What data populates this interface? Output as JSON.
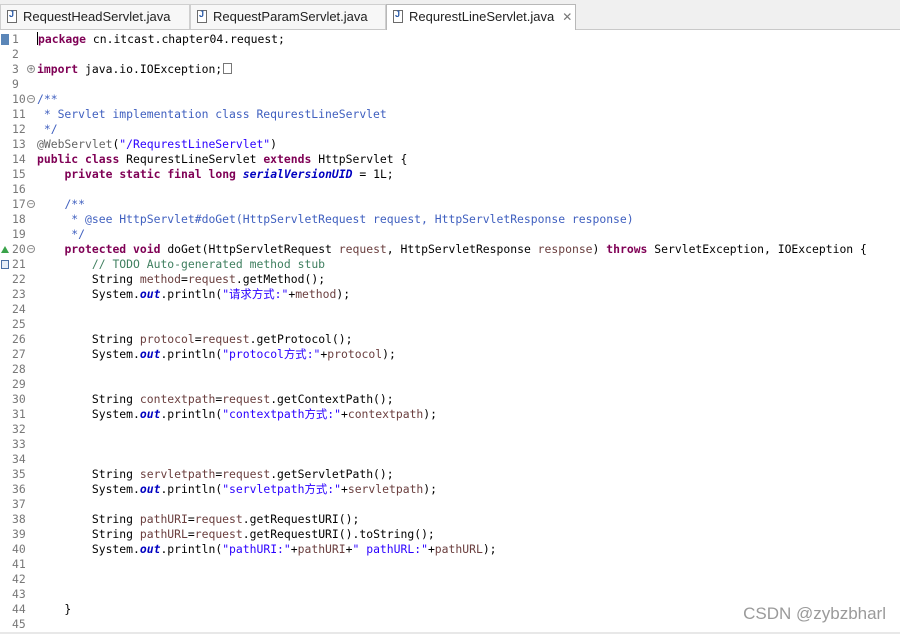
{
  "tabs": [
    {
      "label": "RequestHeadServlet.java",
      "active": false,
      "icon": "java-file-icon"
    },
    {
      "label": "RequestParamServlet.java",
      "active": false,
      "icon": "java-file-icon"
    },
    {
      "label": "RequrestLineServlet.java",
      "active": true,
      "icon": "java-file-icon",
      "close": "✕"
    }
  ],
  "colors": {
    "keyword": "#7f0055",
    "javadoc": "#3f5fbf",
    "line_comment": "#3f7f5f",
    "string": "#2a00ff",
    "annotation": "#646464",
    "field": "#0000c0",
    "variable": "#6a3e3e"
  },
  "fold_glyphs": {
    "expanded": "−",
    "collapsed": "+"
  },
  "code": [
    {
      "n": "1",
      "tokens": [
        [
          "kw",
          "package"
        ],
        [
          "pl",
          " cn.itcast.chapter04.request;"
        ]
      ]
    },
    {
      "n": "2",
      "tokens": []
    },
    {
      "n": "3",
      "fold": "collapsed",
      "tokens": [
        [
          "kw",
          "import"
        ],
        [
          "pl",
          " java.io.IOException;"
        ]
      ],
      "folded_box": true
    },
    {
      "n": "9",
      "tokens": []
    },
    {
      "n": "10",
      "fold": "expanded",
      "tokens": [
        [
          "cm",
          "/**"
        ]
      ]
    },
    {
      "n": "11",
      "tokens": [
        [
          "cm",
          " * Servlet implementation class RequrestLineServlet"
        ]
      ]
    },
    {
      "n": "12",
      "tokens": [
        [
          "cm",
          " */"
        ]
      ]
    },
    {
      "n": "13",
      "tokens": [
        [
          "an",
          "@WebServlet"
        ],
        [
          "pl",
          "("
        ],
        [
          "st",
          "\"/RequrestLineServlet\""
        ],
        [
          "pl",
          ")"
        ]
      ]
    },
    {
      "n": "14",
      "tokens": [
        [
          "kw",
          "public"
        ],
        [
          "pl",
          " "
        ],
        [
          "kw",
          "class"
        ],
        [
          "pl",
          " RequrestLineServlet "
        ],
        [
          "kw",
          "extends"
        ],
        [
          "pl",
          " HttpServlet {"
        ]
      ]
    },
    {
      "n": "15",
      "tokens": [
        [
          "pl",
          "    "
        ],
        [
          "kw",
          "private"
        ],
        [
          "pl",
          " "
        ],
        [
          "kw",
          "static"
        ],
        [
          "pl",
          " "
        ],
        [
          "kw",
          "final"
        ],
        [
          "pl",
          " "
        ],
        [
          "kw",
          "long"
        ],
        [
          "pl",
          " "
        ],
        [
          "fi",
          "serialVersionUID"
        ],
        [
          "pl",
          " = 1L;"
        ]
      ]
    },
    {
      "n": "16",
      "tokens": []
    },
    {
      "n": "17",
      "fold": "expanded",
      "tokens": [
        [
          "pl",
          "    "
        ],
        [
          "cm",
          "/**"
        ]
      ]
    },
    {
      "n": "18",
      "tokens": [
        [
          "pl",
          "    "
        ],
        [
          "cm",
          " * @see HttpServlet#doGet(HttpServletRequest request, HttpServletResponse response)"
        ]
      ]
    },
    {
      "n": "19",
      "tokens": [
        [
          "pl",
          "    "
        ],
        [
          "cm",
          " */"
        ]
      ]
    },
    {
      "n": "20",
      "fold": "expanded",
      "marker": "override",
      "tokens": [
        [
          "pl",
          "    "
        ],
        [
          "kw",
          "protected"
        ],
        [
          "pl",
          " "
        ],
        [
          "kw",
          "void"
        ],
        [
          "pl",
          " doGet(HttpServletRequest "
        ],
        [
          "vr",
          "request"
        ],
        [
          "pl",
          ", HttpServletResponse "
        ],
        [
          "vr",
          "response"
        ],
        [
          "pl",
          ") "
        ],
        [
          "kw",
          "throws"
        ],
        [
          "pl",
          " ServletException, IOException {"
        ]
      ]
    },
    {
      "n": "21",
      "marker": "task",
      "tokens": [
        [
          "pl",
          "        "
        ],
        [
          "lc",
          "// TODO Auto-generated method stub"
        ]
      ]
    },
    {
      "n": "22",
      "tokens": [
        [
          "pl",
          "        String "
        ],
        [
          "vr",
          "method"
        ],
        [
          "pl",
          "="
        ],
        [
          "vr",
          "request"
        ],
        [
          "pl",
          ".getMethod();"
        ]
      ]
    },
    {
      "n": "23",
      "tokens": [
        [
          "pl",
          "        System."
        ],
        [
          "so",
          "out"
        ],
        [
          "pl",
          ".println("
        ],
        [
          "st",
          "\"请求方式:\""
        ],
        [
          "pl",
          "+"
        ],
        [
          "vr",
          "method"
        ],
        [
          "pl",
          ");"
        ]
      ]
    },
    {
      "n": "24",
      "tokens": []
    },
    {
      "n": "25",
      "tokens": []
    },
    {
      "n": "26",
      "tokens": [
        [
          "pl",
          "        String "
        ],
        [
          "vr",
          "protocol"
        ],
        [
          "pl",
          "="
        ],
        [
          "vr",
          "request"
        ],
        [
          "pl",
          ".getProtocol();"
        ]
      ]
    },
    {
      "n": "27",
      "tokens": [
        [
          "pl",
          "        System."
        ],
        [
          "so",
          "out"
        ],
        [
          "pl",
          ".println("
        ],
        [
          "st",
          "\"protocol方式:\""
        ],
        [
          "pl",
          "+"
        ],
        [
          "vr",
          "protocol"
        ],
        [
          "pl",
          ");"
        ]
      ]
    },
    {
      "n": "28",
      "tokens": []
    },
    {
      "n": "29",
      "tokens": []
    },
    {
      "n": "30",
      "tokens": [
        [
          "pl",
          "        String "
        ],
        [
          "vr",
          "contextpath"
        ],
        [
          "pl",
          "="
        ],
        [
          "vr",
          "request"
        ],
        [
          "pl",
          ".getContextPath();"
        ]
      ]
    },
    {
      "n": "31",
      "tokens": [
        [
          "pl",
          "        System."
        ],
        [
          "so",
          "out"
        ],
        [
          "pl",
          ".println("
        ],
        [
          "st",
          "\"contextpath方式:\""
        ],
        [
          "pl",
          "+"
        ],
        [
          "vr",
          "contextpath"
        ],
        [
          "pl",
          ");"
        ]
      ]
    },
    {
      "n": "32",
      "tokens": []
    },
    {
      "n": "33",
      "tokens": []
    },
    {
      "n": "34",
      "tokens": []
    },
    {
      "n": "35",
      "tokens": [
        [
          "pl",
          "        String "
        ],
        [
          "vr",
          "servletpath"
        ],
        [
          "pl",
          "="
        ],
        [
          "vr",
          "request"
        ],
        [
          "pl",
          ".getServletPath();"
        ]
      ]
    },
    {
      "n": "36",
      "tokens": [
        [
          "pl",
          "        System."
        ],
        [
          "so",
          "out"
        ],
        [
          "pl",
          ".println("
        ],
        [
          "st",
          "\"servletpath方式:\""
        ],
        [
          "pl",
          "+"
        ],
        [
          "vr",
          "servletpath"
        ],
        [
          "pl",
          ");"
        ]
      ]
    },
    {
      "n": "37",
      "tokens": []
    },
    {
      "n": "38",
      "tokens": [
        [
          "pl",
          "        String "
        ],
        [
          "vr",
          "pathURI"
        ],
        [
          "pl",
          "="
        ],
        [
          "vr",
          "request"
        ],
        [
          "pl",
          ".getRequestURI();"
        ]
      ]
    },
    {
      "n": "39",
      "tokens": [
        [
          "pl",
          "        String "
        ],
        [
          "vr",
          "pathURL"
        ],
        [
          "pl",
          "="
        ],
        [
          "vr",
          "request"
        ],
        [
          "pl",
          ".getRequestURI().toString();"
        ]
      ]
    },
    {
      "n": "40",
      "tokens": [
        [
          "pl",
          "        System."
        ],
        [
          "so",
          "out"
        ],
        [
          "pl",
          ".println("
        ],
        [
          "st",
          "\"pathURI:\""
        ],
        [
          "pl",
          "+"
        ],
        [
          "vr",
          "pathURI"
        ],
        [
          "pl",
          "+"
        ],
        [
          "st",
          "\" pathURL:\""
        ],
        [
          "pl",
          "+"
        ],
        [
          "vr",
          "pathURL"
        ],
        [
          "pl",
          ");"
        ]
      ]
    },
    {
      "n": "41",
      "tokens": []
    },
    {
      "n": "42",
      "tokens": []
    },
    {
      "n": "43",
      "tokens": []
    },
    {
      "n": "44",
      "tokens": [
        [
          "pl",
          "    }"
        ]
      ]
    },
    {
      "n": "45",
      "tokens": []
    }
  ],
  "watermark": "CSDN @zybzbharl"
}
